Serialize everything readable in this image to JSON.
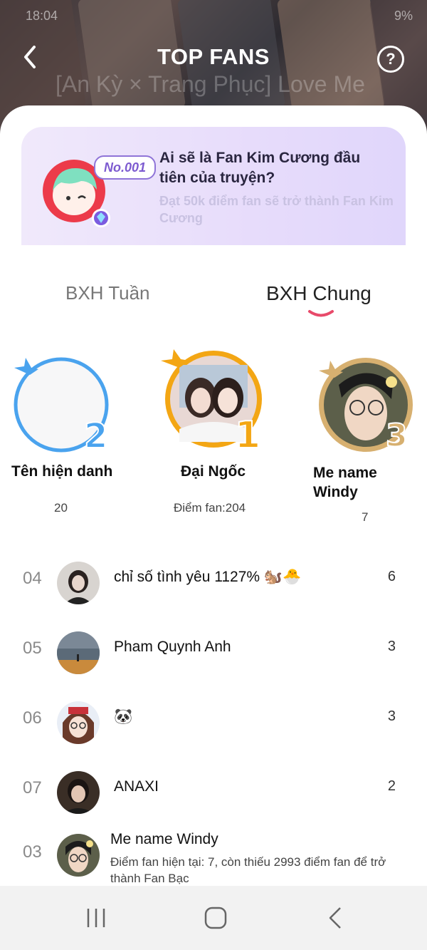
{
  "status_bar": {
    "time": "18:04",
    "battery": "9%"
  },
  "header": {
    "title": "TOP FANS",
    "background_title": "[An Kỳ × Trang Phục] Love Me",
    "help_label": "?"
  },
  "promo": {
    "badge": "No.001",
    "title": "Ai sẽ là Fan Kim Cương đầu tiên của truyện?",
    "subtitle": "Đạt 50k điểm fan sẽ trở thành Fan Kim Cương"
  },
  "tabs": [
    {
      "label": "BXH Tuần",
      "active": false
    },
    {
      "label": "BXH Chung",
      "active": true
    }
  ],
  "podium": {
    "first": {
      "rank": "1",
      "name": "Đại Ngốc",
      "score": "Điểm fan:204"
    },
    "second": {
      "rank": "2",
      "name": "Tên hiện danh",
      "score": "20"
    },
    "third": {
      "rank": "3",
      "name": "Me name Windy",
      "score": "7"
    }
  },
  "rankings": [
    {
      "rank": "04",
      "name": "chỉ số tình yêu 1127% 🐿️🐣",
      "score": "6"
    },
    {
      "rank": "05",
      "name": "Pham Quynh Anh",
      "score": "3"
    },
    {
      "rank": "06",
      "name": "🐼",
      "score": "3"
    },
    {
      "rank": "07",
      "name": "ANAXI",
      "score": "2"
    }
  ],
  "me": {
    "rank": "03",
    "name": "Me name Windy",
    "description": "Điểm fan hiện tại: 7, còn thiếu 2993 điểm fan để trở thành Fan Bạc"
  },
  "colors": {
    "accent": "#e84a6a",
    "gold": "#f3a614",
    "blue": "#4aa3ee",
    "bronze": "#d7b070"
  },
  "nav": {
    "recents_icon": "recents-icon",
    "home_icon": "home-icon",
    "back_icon": "back-icon"
  }
}
